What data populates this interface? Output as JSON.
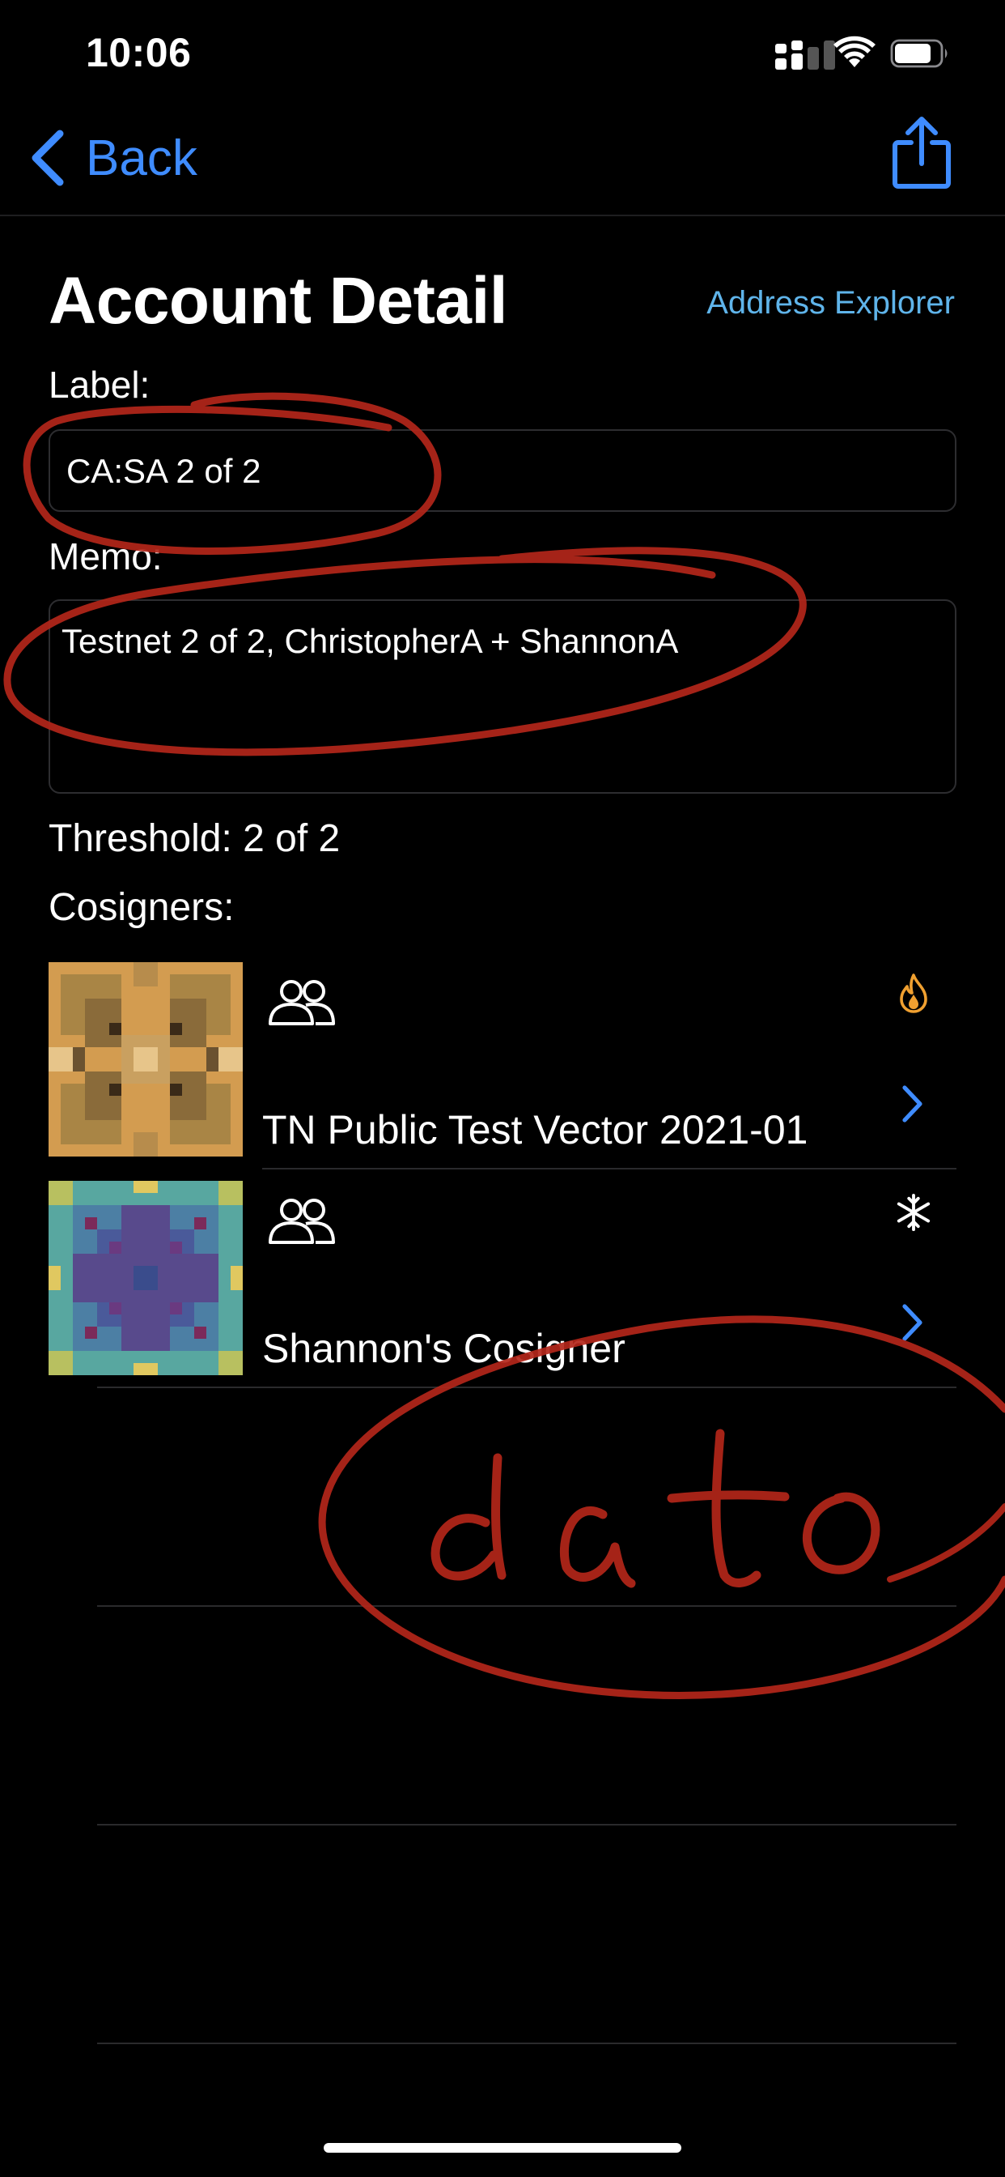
{
  "status_bar": {
    "time": "10:06"
  },
  "nav": {
    "back_label": "Back"
  },
  "header": {
    "title": "Account Detail",
    "address_explorer_label": "Address Explorer"
  },
  "form": {
    "label_caption": "Label:",
    "label_value": "CA:SA 2 of 2",
    "memo_caption": "Memo:",
    "memo_value": "Testnet 2 of 2, ChristopherA + ShannonA"
  },
  "threshold_text": "Threshold: 2 of 2",
  "cosigners_caption": "Cosigners:",
  "cosigners": [
    {
      "name": "TN Public Test Vector 2021-01",
      "status_icon": "fire-icon"
    },
    {
      "name": "Shannon's Cosigner",
      "status_icon": "snowflake-icon"
    }
  ],
  "annotation": {
    "handwritten_text": "data",
    "color": "#b3261a"
  },
  "colors": {
    "accent": "#3f8cff",
    "link": "#5fb4ea",
    "fire": "#f0a030"
  }
}
